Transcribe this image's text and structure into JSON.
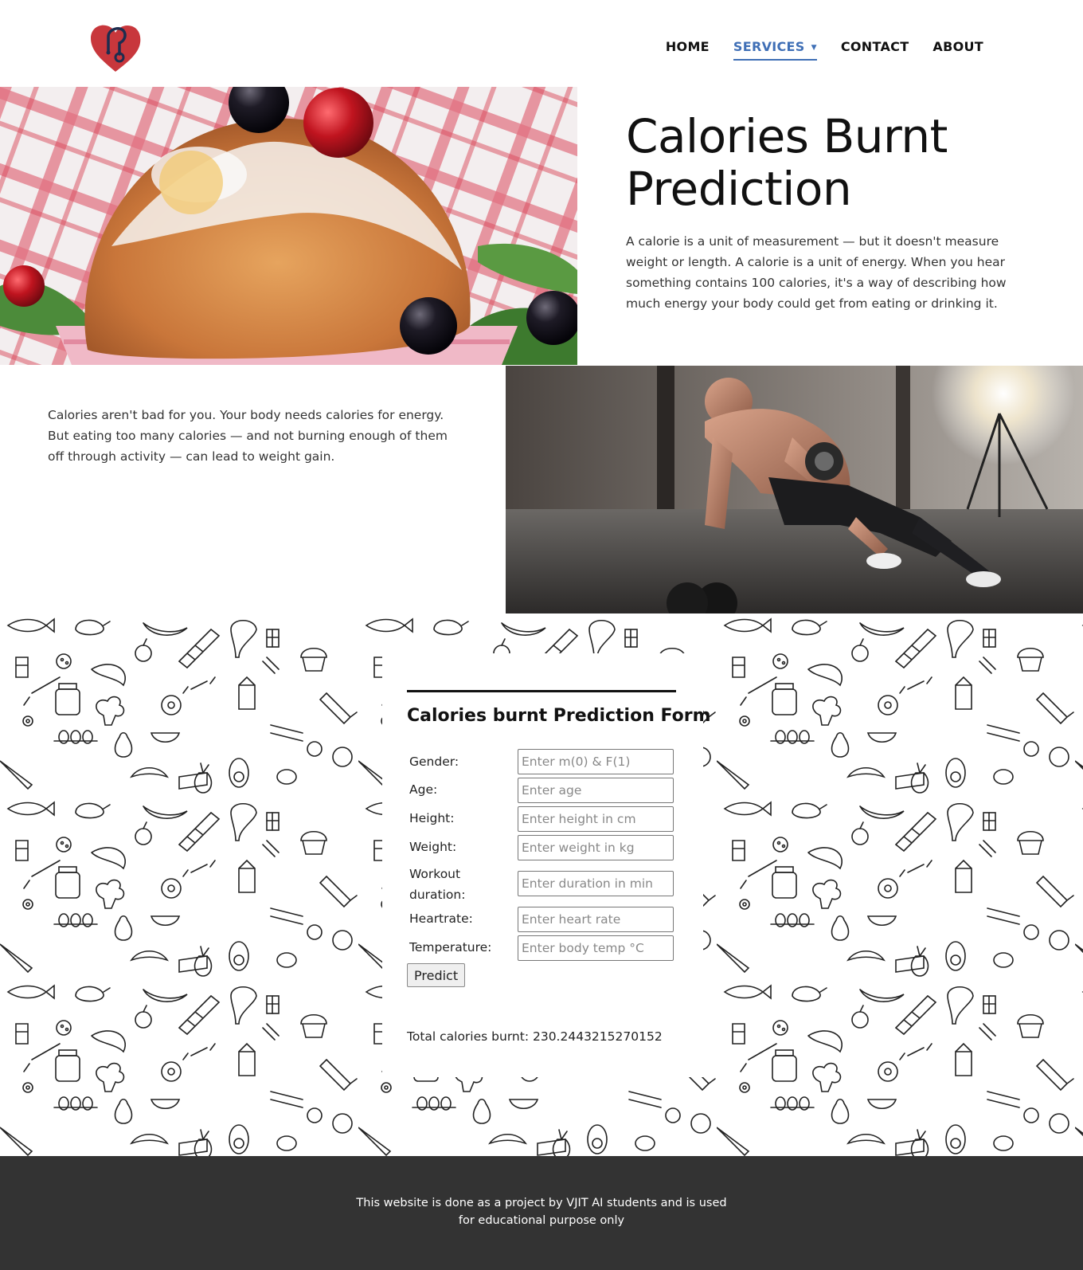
{
  "nav": {
    "home": "HOME",
    "services": "SERVICES",
    "contact": "CONTACT",
    "about": "ABOUT",
    "accent_color": "#3f6fb6"
  },
  "hero": {
    "title": "Calories Burnt Prediction",
    "paragraph": "A calorie is a unit of measurement — but it doesn't measure weight or length. A calorie is a unit of energy. When you hear something contains 100 calories, it's a way of describing how much energy your body could get from eating or drinking it."
  },
  "section2": {
    "paragraph": "Calories aren't bad for you. Your body needs calories for energy. But eating too many calories — and not burning enough of them off through activity — can lead to weight gain."
  },
  "form": {
    "title": "Calories burnt Prediction Form",
    "fields": {
      "gender": {
        "label": "Gender:",
        "placeholder": "Enter m(0) & F(1)"
      },
      "age": {
        "label": "Age:",
        "placeholder": "Enter age"
      },
      "height": {
        "label": "Height:",
        "placeholder": "Enter height in cm"
      },
      "weight": {
        "label": "Weight:",
        "placeholder": "Enter weight in kg"
      },
      "duration": {
        "label_line1": "Workout",
        "label_line2": "duration:",
        "placeholder": "Enter duration in min"
      },
      "heartrate": {
        "label": "Heartrate:",
        "placeholder": "Enter heart rate"
      },
      "temperature": {
        "label": "Temperature:",
        "placeholder": "Enter body temp °C"
      }
    },
    "button": "Predict",
    "result": "Total calories burnt: 230.2443215270152"
  },
  "footer": {
    "line1": "This website is done as a project by VJIT AI students and is used",
    "line2": "for educational purpose only",
    "background": "#333333"
  }
}
